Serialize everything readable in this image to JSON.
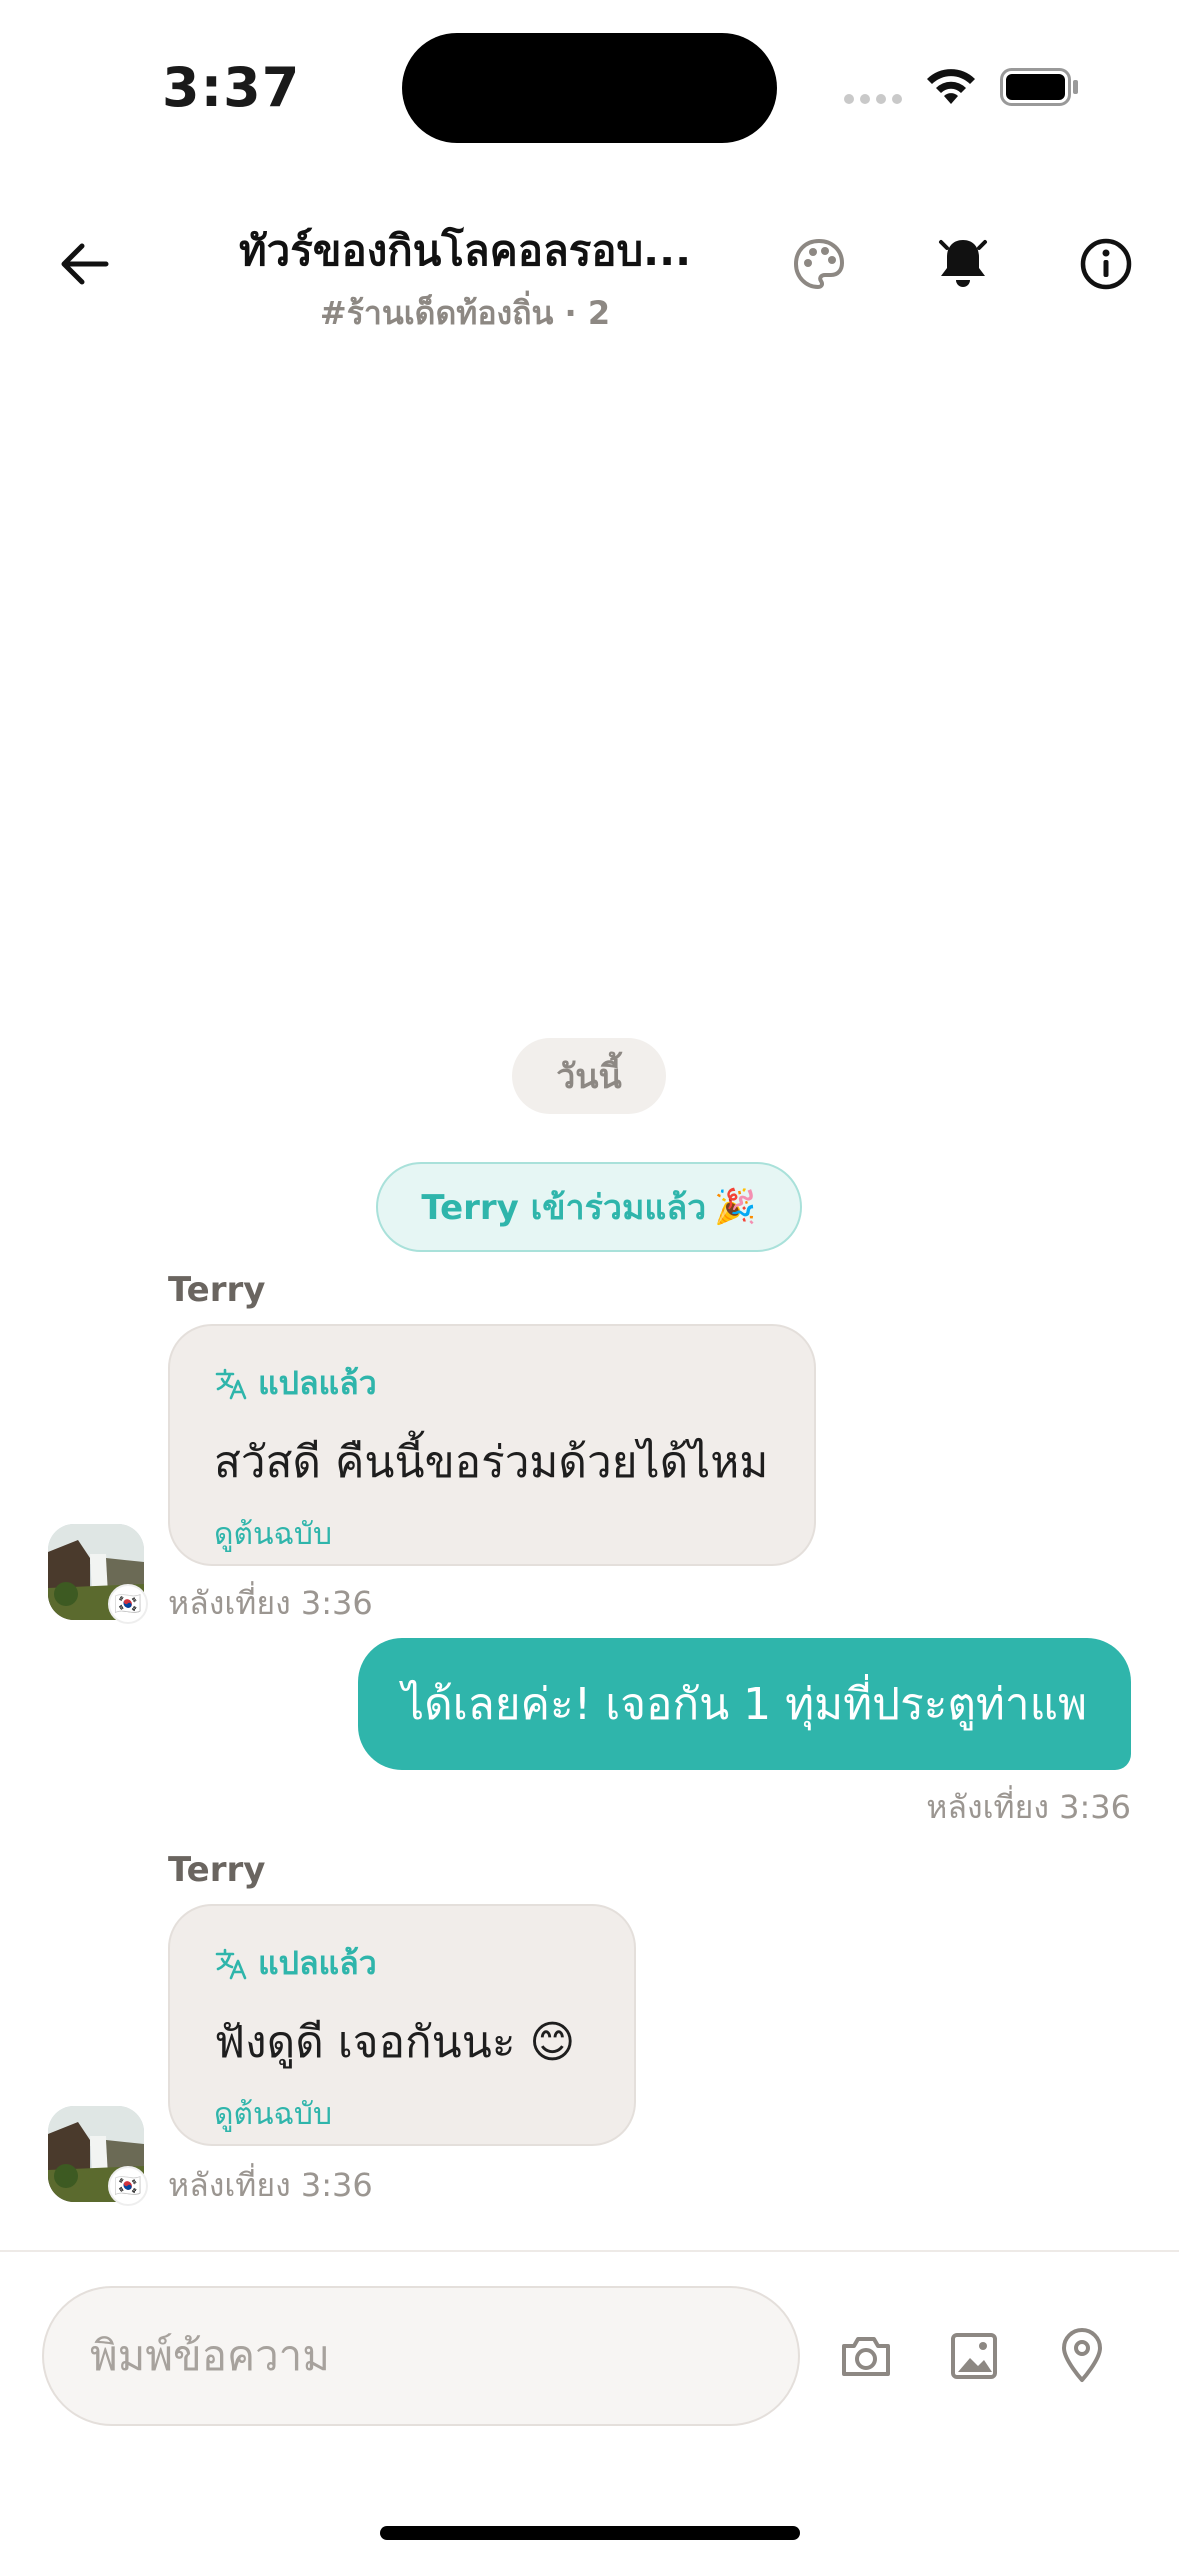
{
  "status_bar": {
    "time": "3:37"
  },
  "header": {
    "title": "ทัวร์ของกินโลคอลรอบ...",
    "subtitle": "#ร้านเด็ดท้องถิ่น · 2"
  },
  "chat": {
    "date_divider": "วันนี้",
    "join_notice": "Terry เข้าร่วมแล้ว",
    "join_emoji": "🎉",
    "messages": [
      {
        "sender": "Terry",
        "translated_label": "แปลแล้ว",
        "text": "สวัสดี คืนนี้ขอร่วมด้วยได้ไหม",
        "view_original": "ดูต้นฉบับ",
        "time": "หลังเที่ยง 3:36",
        "flag": "🇰🇷"
      },
      {
        "outgoing": true,
        "text": "ได้เลยค่ะ! เจอกัน 1 ทุ่มที่ประตูท่าแพ",
        "time": "หลังเที่ยง 3:36"
      },
      {
        "sender": "Terry",
        "translated_label": "แปลแล้ว",
        "text": "ฟังดูดี เจอกันนะ 😊",
        "view_original": "ดูต้นฉบับ",
        "time": "หลังเที่ยง 3:36",
        "flag": "🇰🇷"
      }
    ]
  },
  "composer": {
    "placeholder": "พิมพ์ข้อความ"
  },
  "colors": {
    "accent": "#2fb5ab",
    "bubble_in": "#f1edea",
    "muted": "#9b9691"
  },
  "icons": [
    "back-arrow-icon",
    "palette-icon",
    "bell-icon",
    "info-icon",
    "translate-icon",
    "camera-icon",
    "image-icon",
    "location-pin-icon",
    "wifi-icon",
    "battery-icon"
  ]
}
